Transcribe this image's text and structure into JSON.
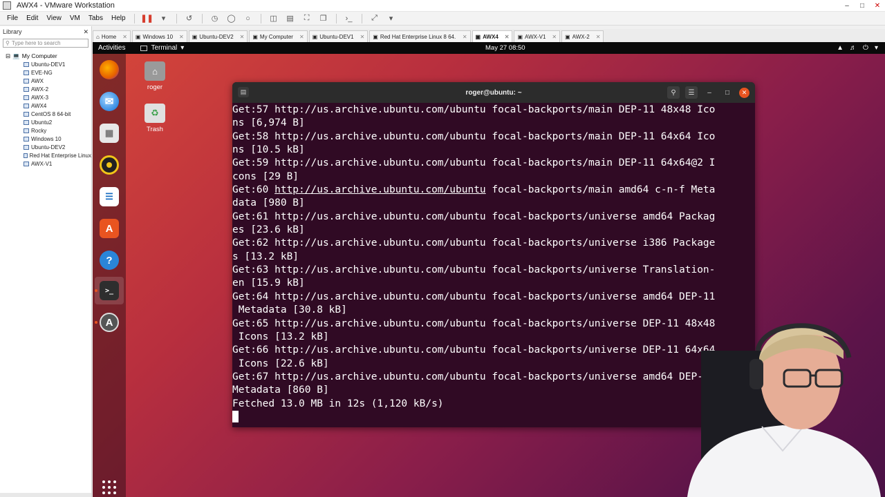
{
  "vmware": {
    "title": "AWX4 - VMware Workstation",
    "menus": [
      "File",
      "Edit",
      "View",
      "VM",
      "Tabs",
      "Help"
    ],
    "library": {
      "label": "Library",
      "search_placeholder": "Type here to search",
      "root": "My Computer",
      "items": [
        "Ubuntu-DEV1",
        "EVE-NG",
        "AWX",
        "AWX-2",
        "AWX-3",
        "AWX4",
        "CentOS 8 64-bit",
        "Ubuntu2",
        "Rocky",
        "Windows 10",
        "Ubuntu-DEV2",
        "Red Hat Enterprise Linux",
        "AWX-V1"
      ]
    },
    "tabs": [
      {
        "label": "Home",
        "active": false
      },
      {
        "label": "Windows 10",
        "active": false
      },
      {
        "label": "Ubuntu-DEV2",
        "active": false
      },
      {
        "label": "My Computer",
        "active": false
      },
      {
        "label": "Ubuntu-DEV1",
        "active": false
      },
      {
        "label": "Red Hat Enterprise Linux 8 64...",
        "active": false
      },
      {
        "label": "AWX4",
        "active": true
      },
      {
        "label": "AWX-V1",
        "active": false
      },
      {
        "label": "AWX-2",
        "active": false
      }
    ]
  },
  "ubuntu": {
    "activities": "Activities",
    "app_menu": "Terminal",
    "clock": "May 27  08:50",
    "desktop_icons": [
      "roger",
      "Trash"
    ]
  },
  "terminal": {
    "title": "roger@ubuntu: ~",
    "lines": [
      "Get:57 http://us.archive.ubuntu.com/ubuntu focal-backports/main DEP-11 48x48 Ico",
      "ns [6,974 B]",
      "Get:58 http://us.archive.ubuntu.com/ubuntu focal-backports/main DEP-11 64x64 Ico",
      "ns [10.5 kB]",
      "Get:59 http://us.archive.ubuntu.com/ubuntu focal-backports/main DEP-11 64x64@2 I",
      "cons [29 B]",
      "Get:60 http://us.archive.ubuntu.com/ubuntu focal-backports/main amd64 c-n-f Meta",
      "data [980 B]",
      "Get:61 http://us.archive.ubuntu.com/ubuntu focal-backports/universe amd64 Packag",
      "es [23.6 kB]",
      "Get:62 http://us.archive.ubuntu.com/ubuntu focal-backports/universe i386 Package",
      "s [13.2 kB]",
      "Get:63 http://us.archive.ubuntu.com/ubuntu focal-backports/universe Translation-",
      "en [15.9 kB]",
      "Get:64 http://us.archive.ubuntu.com/ubuntu focal-backports/universe amd64 DEP-11",
      " Metadata [30.8 kB]",
      "Get:65 http://us.archive.ubuntu.com/ubuntu focal-backports/universe DEP-11 48x48",
      " Icons [13.2 kB]",
      "Get:66 http://us.archive.ubuntu.com/ubuntu focal-backports/universe DEP-11 64x64",
      " Icons [22.6 kB]",
      "Get:67 http://us.archive.ubuntu.com/ubuntu focal-backports/universe amd64 DEP-11",
      "Metadata [860 B]",
      "Fetched 13.0 MB in 12s (1,120 kB/s)"
    ],
    "hover_url": "http://us.archive.ubuntu.com/ubuntu"
  },
  "colors": {
    "terminal_bg": "#300a24",
    "ubuntu_orange": "#e95420",
    "topbar_bg": "#0a0a0a"
  }
}
